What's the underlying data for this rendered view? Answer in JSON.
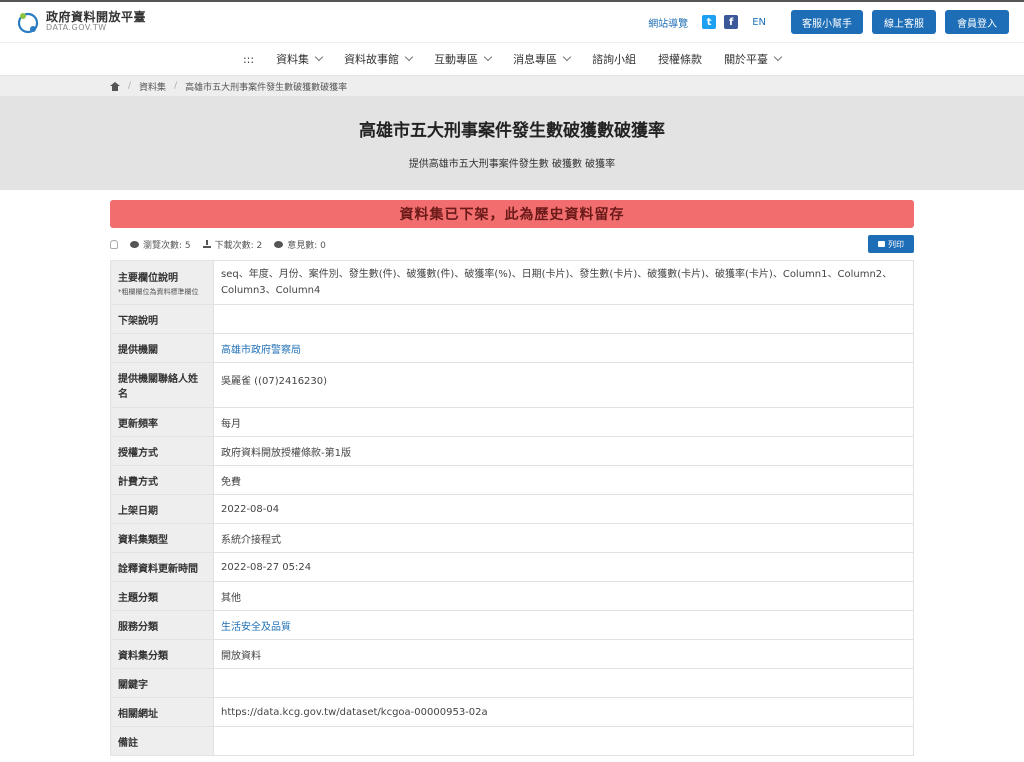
{
  "header": {
    "logo_title": "政府資料開放平臺",
    "logo_sub": "DATA.GOV.TW",
    "site_guide": "網站導覽",
    "twitter_icon": "twitter-icon",
    "facebook_icon": "facebook-icon",
    "lang": "EN",
    "buttons": [
      "客服小幫手",
      "線上客服",
      "會員登入"
    ]
  },
  "nav": {
    "menu_icon": ":::",
    "items": [
      {
        "label": "資料集",
        "dropdown": true
      },
      {
        "label": "資料故事館",
        "dropdown": true
      },
      {
        "label": "互動專區",
        "dropdown": true
      },
      {
        "label": "消息專區",
        "dropdown": true
      },
      {
        "label": "諮詢小組",
        "dropdown": false
      },
      {
        "label": "授權條款",
        "dropdown": false
      },
      {
        "label": "關於平臺",
        "dropdown": true
      }
    ]
  },
  "breadcrumb": {
    "items": [
      "資料集",
      "高雄市五大刑事案件發生數破獲數破獲率"
    ]
  },
  "dataset": {
    "title": "高雄市五大刑事案件發生數破獲數破獲率",
    "subtitle": "提供高雄市五大刑事案件發生數 破獲數 破獲率",
    "alert": "資料集已下架，此為歷史資料留存",
    "views": "瀏覽次數: 5",
    "downloads": "下載次數: 2",
    "comments": "意見數: 0",
    "print": "列印"
  },
  "fields": {
    "main_columns": {
      "label": "主要欄位說明",
      "note": "*粗欄欄位為資料標準欄位",
      "value": "seq、年度、月份、案件別、發生數(件)、破獲數(件)、破獲率(%)、日期(卡片)、發生數(卡片)、破獲數(卡片)、破獲率(卡片)、Column1、Column2、Column3、Column4"
    },
    "delist_reason": {
      "label": "下架說明",
      "value": ""
    },
    "provider": {
      "label": "提供機關",
      "value": "高雄市政府警察局"
    },
    "contact": {
      "label": "提供機關聯絡人姓名",
      "value": "吳麗雀 ((07)2416230)"
    },
    "frequency": {
      "label": "更新頻率",
      "value": "每月"
    },
    "license": {
      "label": "授權方式",
      "value": "政府資料開放授權條款-第1版"
    },
    "fee": {
      "label": "計費方式",
      "value": "免費"
    },
    "published": {
      "label": "上架日期",
      "value": "2022-08-04"
    },
    "dataset_type": {
      "label": "資料集類型",
      "value": "系統介接程式"
    },
    "last_updated": {
      "label": "詮釋資料更新時間",
      "value": "2022-08-27 05:24"
    },
    "theme": {
      "label": "主題分類",
      "value": "其他"
    },
    "service": {
      "label": "服務分類",
      "value": "生活安全及品質"
    },
    "category": {
      "label": "資料集分類",
      "value": "開放資料"
    },
    "keywords": {
      "label": "關鍵字",
      "value": ""
    },
    "related_url": {
      "label": "相關網址",
      "value": "https://data.kcg.gov.tw/dataset/kcgoa-00000953-02a"
    },
    "remarks": {
      "label": "備註",
      "value": ""
    }
  }
}
